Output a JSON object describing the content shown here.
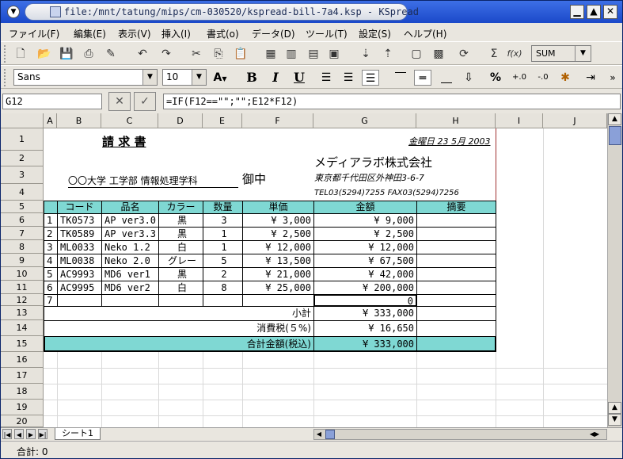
{
  "window": {
    "title": "file:/mnt/tatung/mips/cm-030520/kspread-bill-7a4.ksp - KSpread",
    "minimize": "▁",
    "maximize": "▲",
    "close": "✕"
  },
  "menu": [
    "ファイル(F)",
    "編集(E)",
    "表示(V)",
    "挿入(I)",
    "書式(o)",
    "データ(D)",
    "ツール(T)",
    "設定(S)",
    "ヘルプ(H)"
  ],
  "toolbar": {
    "sum_label": "Σ",
    "fx_label": "f(x)",
    "function_combo": "SUM",
    "font_name": "Sans",
    "font_size": "10",
    "bold": "B",
    "italic": "I",
    "underline": "U",
    "percent": "%"
  },
  "formula_bar": {
    "cell_ref": "G12",
    "cancel": "✕",
    "accept": "✓",
    "formula": "=IF(F12==\"\";\"\";E12*F12)"
  },
  "columns": [
    "A",
    "B",
    "C",
    "D",
    "E",
    "F",
    "G",
    "H",
    "I",
    "J"
  ],
  "rows": [
    "1",
    "2",
    "3",
    "4",
    "5",
    "6",
    "7",
    "8",
    "9",
    "10",
    "11",
    "12",
    "13",
    "14",
    "15",
    "16",
    "17",
    "18",
    "19",
    "20"
  ],
  "invoice": {
    "title": "請 求 書",
    "date": "金曜日 23 5月 2003",
    "company": "メディアラボ株式会社",
    "address": "東京都千代田区外神田3-6-7",
    "contact": "TEL03(5294)7255 FAX03(5294)7256",
    "recipient": "〇〇大学 工学部 情報処理学科",
    "recipient_suffix": "御中",
    "headers": [
      "コード",
      "品名",
      "カラー",
      "数量",
      "単価",
      "金額",
      "摘要"
    ],
    "items": [
      {
        "no": "1",
        "code": "TK0573",
        "name": "AP ver3.0",
        "color": "黒",
        "qty": "3",
        "price": "¥ 3,000",
        "amount": "¥ 9,000"
      },
      {
        "no": "2",
        "code": "TK0589",
        "name": "AP ver3.3",
        "color": "黒",
        "qty": "1",
        "price": "¥ 2,500",
        "amount": "¥ 2,500"
      },
      {
        "no": "3",
        "code": "ML0033",
        "name": "Neko 1.2",
        "color": "白",
        "qty": "1",
        "price": "¥ 12,000",
        "amount": "¥ 12,000"
      },
      {
        "no": "4",
        "code": "ML0038",
        "name": "Neko 2.0",
        "color": "グレー",
        "qty": "5",
        "price": "¥ 13,500",
        "amount": "¥ 67,500"
      },
      {
        "no": "5",
        "code": "AC9993",
        "name": "MD6 ver1",
        "color": "黒",
        "qty": "2",
        "price": "¥ 21,000",
        "amount": "¥ 42,000"
      },
      {
        "no": "6",
        "code": "AC9995",
        "name": "MD6 ver2",
        "color": "白",
        "qty": "8",
        "price": "¥ 25,000",
        "amount": "¥ 200,000"
      },
      {
        "no": "7",
        "code": "",
        "name": "",
        "color": "",
        "qty": "",
        "price": "",
        "amount": "0"
      }
    ],
    "subtotal_label": "小計",
    "subtotal": "¥ 333,000",
    "tax_label": "消費税(５%)",
    "tax": "¥ 16,650",
    "total_label": "合計金額(税込)",
    "total": "¥ 333,000"
  },
  "sheet_tab": "シート1",
  "status": "合計: 0"
}
